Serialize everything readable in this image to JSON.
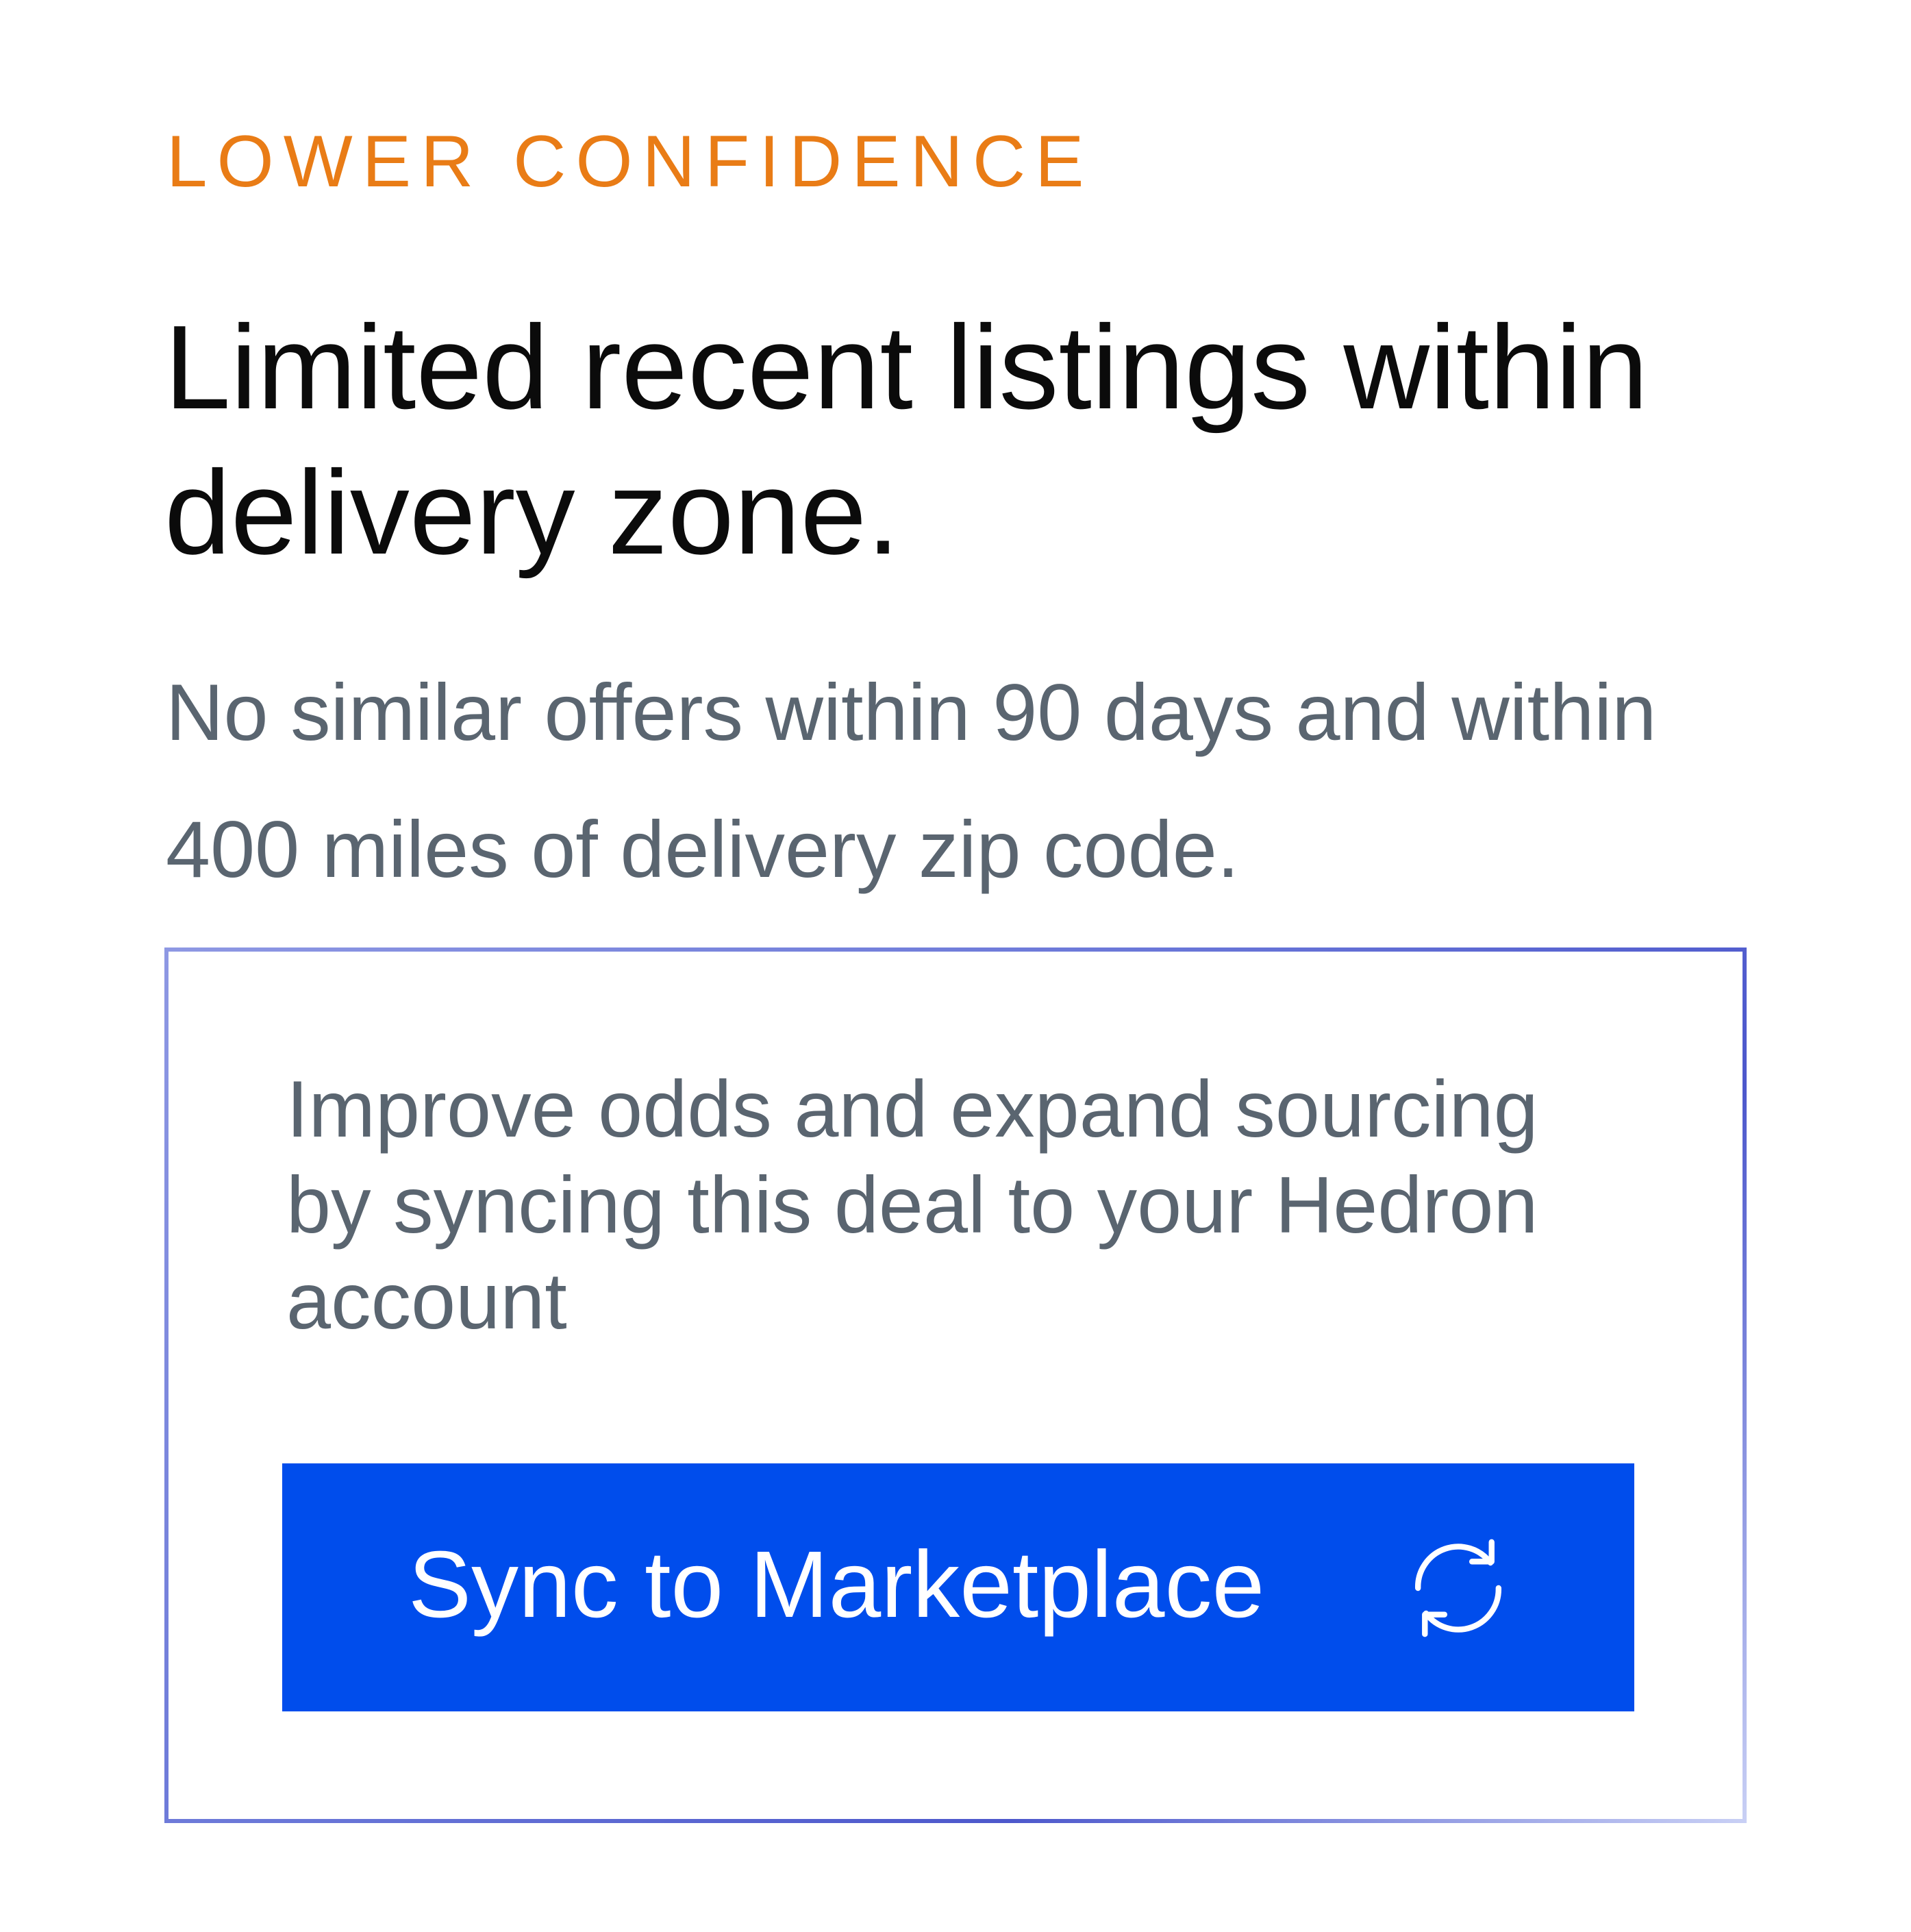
{
  "confidence_label": "LOWER CONFIDENCE",
  "headline": "Limited recent listings within delivery zone.",
  "subtext": "No similar offers within 90 days and within 400 miles of delivery zip code.",
  "callout": {
    "message": "Improve odds and expand sourcing by  syncing this deal to your Hedron account",
    "button_label": "Sync to Marketplace",
    "button_icon": "sync-icon"
  },
  "colors": {
    "accent_orange": "#e97c16",
    "button_blue": "#004dec",
    "callout_border": "#5a66d0"
  }
}
